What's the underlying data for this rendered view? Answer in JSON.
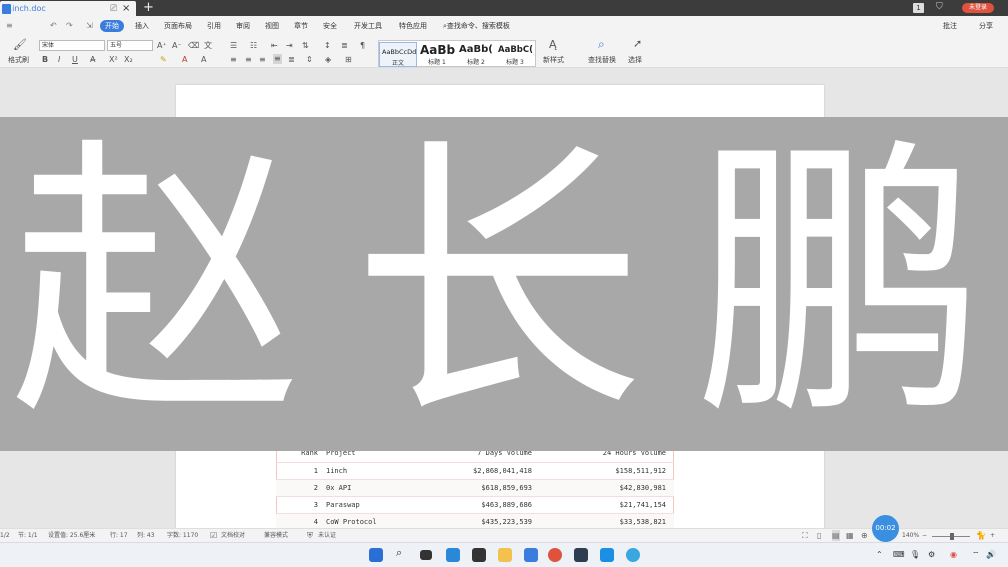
{
  "window": {
    "tab_title": "1inch.doc",
    "new_tab_symbol": "+",
    "close_symbol": "×",
    "monitor_symbol": "⎚",
    "notification_count": "1",
    "shirt_symbol": "⛉",
    "login_badge": "未登录"
  },
  "menu": {
    "file_symbols": [
      "≡",
      "↶",
      "↷",
      "⇲"
    ],
    "tabs": [
      "开始",
      "插入",
      "页面布局",
      "引用",
      "审阅",
      "视图",
      "章节",
      "安全",
      "开发工具",
      "特色应用"
    ],
    "active_tab": "开始",
    "search_placeholder": "查找命令、搜索模板",
    "search_symbol": "⌕",
    "annotation": "批注",
    "share": "分享"
  },
  "ribbon": {
    "format_painter": "格式刷",
    "font_family": "宋体",
    "font_size": "五号",
    "bold": "B",
    "italic": "I",
    "underline": "U",
    "styles": [
      {
        "sample": "AaBbCcDd",
        "label": "正文"
      },
      {
        "sample": "AaBb",
        "label": "标题 1"
      },
      {
        "sample": "AaBb(",
        "label": "标题 2"
      },
      {
        "sample": "AaBbC(",
        "label": "标题 3"
      }
    ],
    "new_style": "新样式",
    "find_replace": "查找替换",
    "select": "选择"
  },
  "overlay": {
    "text": "赵长鹏",
    "background": "#a8a8a8"
  },
  "table": {
    "columns": [
      "Rank",
      "Project",
      "7 Days Volume",
      "24 Hours Volume"
    ],
    "rows": [
      {
        "rank": "1",
        "project": "1inch",
        "vol7d": "$2,868,041,418",
        "vol24h": "$158,511,912"
      },
      {
        "rank": "2",
        "project": "0x API",
        "vol7d": "$618,859,693",
        "vol24h": "$42,830,981"
      },
      {
        "rank": "3",
        "project": "Paraswap",
        "vol7d": "$463,889,686",
        "vol24h": "$21,741,154"
      },
      {
        "rank": "4",
        "project": "CoW Protocol",
        "vol7d": "$435,223,539",
        "vol24h": "$33,538,821"
      }
    ]
  },
  "status": {
    "page": "1/2",
    "section": "节: 1/1",
    "setting": "设置值: 25.6厘米",
    "line": "行: 17",
    "col": "列: 43",
    "words": "字数: 1170",
    "proof": "文档校对",
    "compat": "兼容模式",
    "cert": "未认证",
    "timer": "00:02",
    "zoom": "140%"
  },
  "colors": {
    "accent": "#3b7ddd",
    "title_bar": "#3c3c3c",
    "login_badge": "#e0523e"
  }
}
